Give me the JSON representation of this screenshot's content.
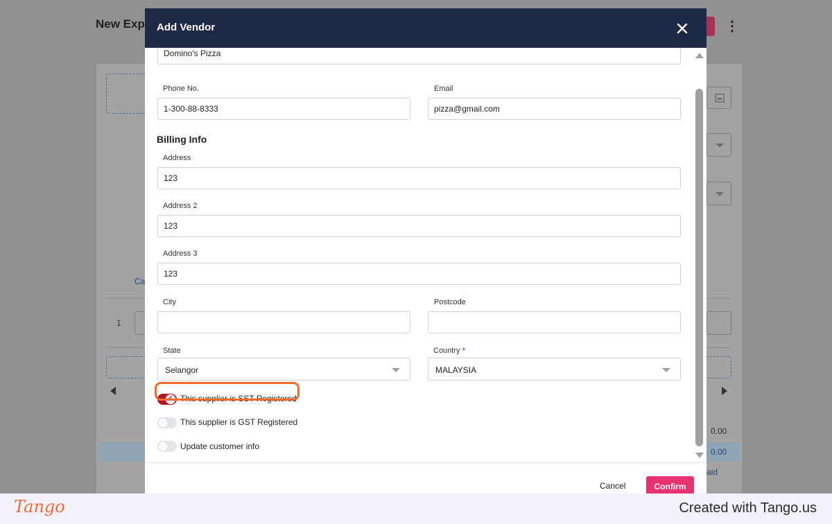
{
  "background": {
    "page_title": "New Expe",
    "row_number": "1",
    "partial_label": "Ca",
    "value_1": "0.00",
    "value_2": "0.00",
    "partial_paid": "aid"
  },
  "modal": {
    "title": "Add Vendor",
    "vendor_name_value": "Domino's Pizza",
    "phone_label": "Phone No.",
    "phone_value": "1-300-88-8333",
    "email_label": "Email",
    "email_value": "pizza@gmail.com",
    "billing_section": "Billing Info",
    "address_label": "Address",
    "address_value": "123",
    "address2_label": "Address 2",
    "address2_value": "123",
    "address3_label": "Address 3",
    "address3_value": "123",
    "city_label": "City",
    "city_value": "",
    "postcode_label": "Postcode",
    "postcode_value": "",
    "state_label": "State",
    "state_value": "Selangor",
    "country_label": "Country",
    "country_required": "*",
    "country_value": "MALAYSIA",
    "toggles": [
      {
        "label": "This supplier is SST Registered",
        "on": true
      },
      {
        "label": "This supplier is GST Registered",
        "on": false
      },
      {
        "label": "Update customer info",
        "on": false
      }
    ],
    "cancel_label": "Cancel",
    "confirm_label": "Confirm"
  },
  "footer": {
    "logo": "Tango",
    "credit": "Created with Tango.us"
  },
  "colors": {
    "header_bg": "#1e2945",
    "confirm_bg": "#e8336f",
    "toggle_on": "#b3151f",
    "highlight": "#f36b2a",
    "tango_orange": "#f06b3c"
  }
}
